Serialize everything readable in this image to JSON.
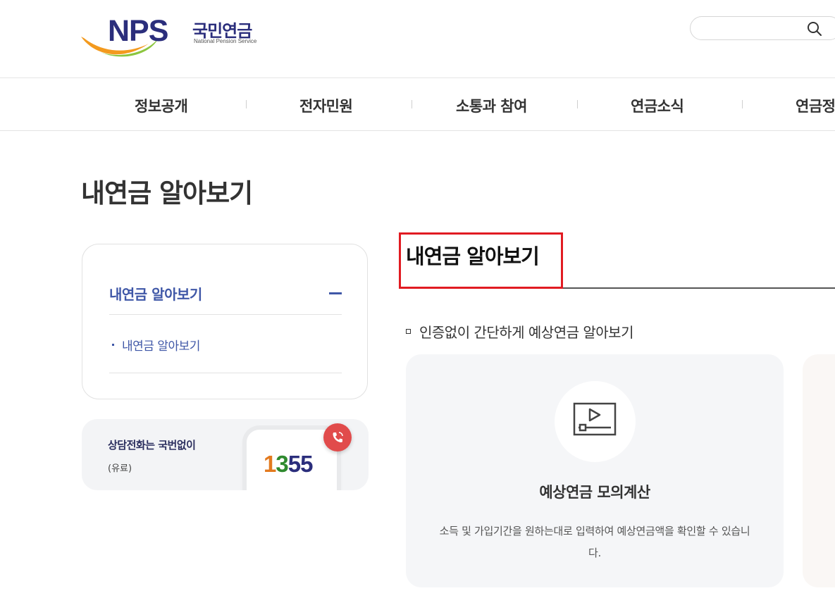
{
  "header": {
    "logo_mark": "NPS",
    "logo_korean": "국민연금",
    "logo_english": "National Pension Service",
    "search": {
      "value": "",
      "placeholder": "",
      "icon": "search-icon"
    }
  },
  "gnb": {
    "items": [
      {
        "label": "정보공개"
      },
      {
        "label": "전자민원"
      },
      {
        "label": "소통과 참여"
      },
      {
        "label": "연금소식"
      },
      {
        "label": "연금정"
      }
    ]
  },
  "page_title": "내연금 알아보기",
  "side_menu": {
    "heading": "내연금 알아보기",
    "toggle_icon": "minus-icon",
    "sub_items": [
      {
        "label": "내연금 알아보기"
      }
    ]
  },
  "call_banner": {
    "title": "상담전화는 국번없이",
    "subtitle": "(유료)",
    "number_parts": [
      "1",
      "3",
      "5",
      "5"
    ],
    "icon": "phone-call-icon"
  },
  "content": {
    "title": "내연금 알아보기",
    "section_label": "인증없이 간단하게 예상연금 알아보기",
    "cards": [
      {
        "icon": "video-play-icon",
        "title": "예상연금 모의계산",
        "description": "소득 및 가입기간을 원하는대로 입력하여 예상연금액을 확인할 수 있습니다."
      }
    ]
  },
  "colors": {
    "brand_navy": "#2b2e7c",
    "accent_blue": "#3f57a7",
    "highlight_red": "#e11b22",
    "call_red": "#e14b4b"
  }
}
